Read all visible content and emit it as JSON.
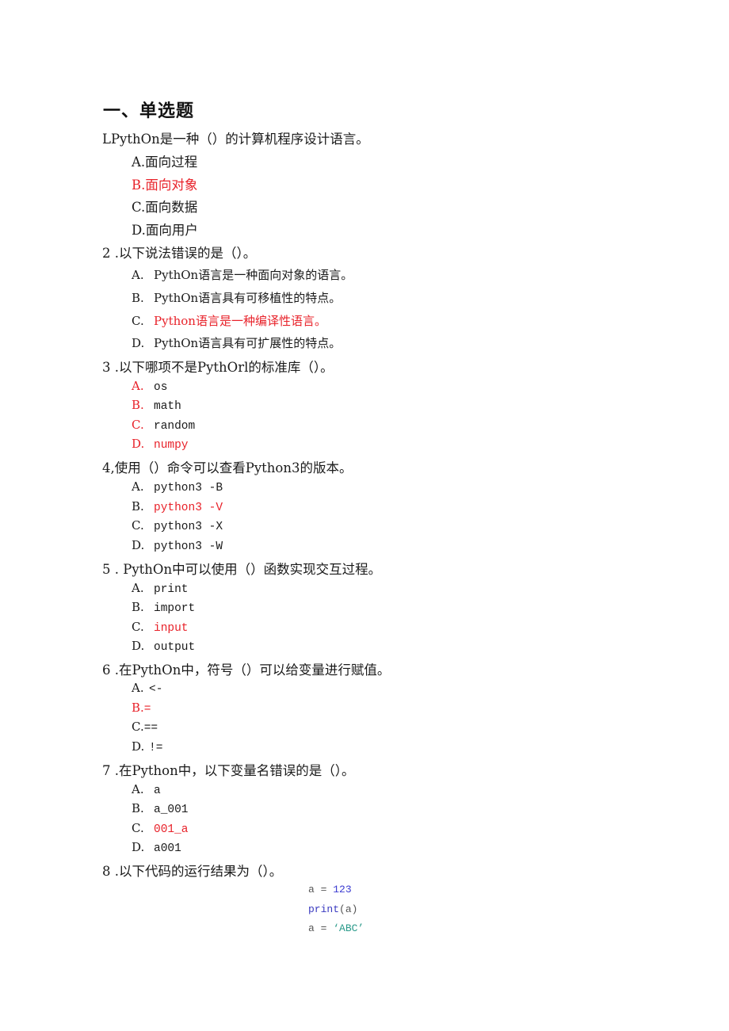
{
  "section_title": "一、单选题",
  "questions": [
    {
      "stem": "LPythOn是一种（）的计算机程序设计语言。",
      "options": [
        {
          "label": "A.",
          "text": "面向过程",
          "correct": false
        },
        {
          "label": "B.",
          "text": "面向对象",
          "correct": true
        },
        {
          "label": "C.",
          "text": "面向数据",
          "correct": false
        },
        {
          "label": "D.",
          "text": "面向用户",
          "correct": false
        }
      ]
    },
    {
      "stem": "2  .以下说法错误的是（）。",
      "options": [
        {
          "label": "A.",
          "text": "PythOn语言是一种面向对象的语言。",
          "correct": false
        },
        {
          "label": "B.",
          "text": "PythOn语言具有可移植性的特点。",
          "correct": false
        },
        {
          "label": "C.",
          "text": "Python语言是一种编译性语言。",
          "correct": true
        },
        {
          "label": "D.",
          "text": "PythOn语言具有可扩展性的特点。",
          "correct": false
        }
      ]
    },
    {
      "stem": "3  .以下哪项不是PythOrl的标准库（）。",
      "options": [
        {
          "label": "A.",
          "text": "os",
          "correct": false
        },
        {
          "label": "B.",
          "text": "math",
          "correct": false
        },
        {
          "label": "C.",
          "text": "random",
          "correct": false
        },
        {
          "label": "D.",
          "text": "numpy",
          "correct": true
        }
      ]
    },
    {
      "stem": "4,使用（）命令可以查看Python3的版本。",
      "options": [
        {
          "label": "A.",
          "text": "python3 -B",
          "correct": false
        },
        {
          "label": "B.",
          "text": "python3 -V",
          "correct": true
        },
        {
          "label": "C.",
          "text": "python3 -X",
          "correct": false
        },
        {
          "label": "D.",
          "text": "python3 -W",
          "correct": false
        }
      ]
    },
    {
      "stem": "5  . PythOn中可以使用（）函数实现交互过程。",
      "options": [
        {
          "label": "A.",
          "text": "print",
          "correct": false
        },
        {
          "label": "B.",
          "text": "import",
          "correct": false
        },
        {
          "label": "C.",
          "text": "input",
          "correct": true
        },
        {
          "label": "D.",
          "text": "output",
          "correct": false
        }
      ]
    },
    {
      "stem": "6  .在PythOn中，符号（）可以给变量进行赋值。",
      "options": [
        {
          "label": "A.",
          "text": "<-",
          "correct": false
        },
        {
          "label": "B.",
          "text": "=",
          "correct": true
        },
        {
          "label": "C.",
          "text": "==",
          "correct": false
        },
        {
          "label": "D.",
          "text": "!=",
          "correct": false
        }
      ]
    },
    {
      "stem": "7  .在Python中，以下变量名错误的是（）。",
      "options": [
        {
          "label": "A.",
          "text": "a",
          "correct": false
        },
        {
          "label": "B.",
          "text": "a_001",
          "correct": false
        },
        {
          "label": "C.",
          "text": "001_a",
          "correct": true
        },
        {
          "label": "D.",
          "text": "a001",
          "correct": false
        }
      ]
    },
    {
      "stem": "8  .以下代码的运行结果为（）。",
      "code": {
        "line1_var": "a = ",
        "line1_val": "123",
        "line2_fn": "print",
        "line2_args": "(a)",
        "line3_var": "a = ",
        "line3_val": "‘ABC’"
      }
    }
  ],
  "colors": {
    "correct_answer": "#e8222a",
    "text": "#1a1a1a",
    "code_number": "#3a3ad0",
    "code_string": "#2a9a8a"
  }
}
